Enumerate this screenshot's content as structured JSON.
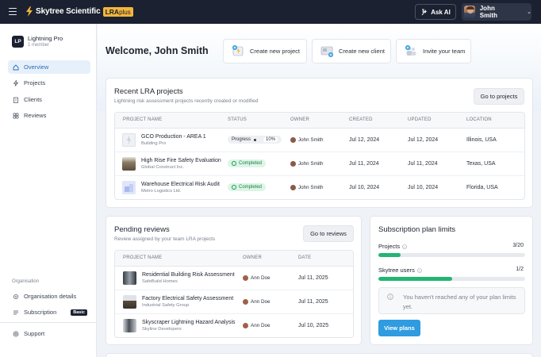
{
  "topbar": {
    "brand_name": "Skytree Scientific",
    "brand_badge": "LRA",
    "brand_badge_suffix": "plus",
    "ask_ai_label": "Ask AI",
    "user_name": "John Smith"
  },
  "sidebar": {
    "org_name": "Lightning Pro",
    "org_initials": "LP",
    "org_members": "1 member",
    "nav": [
      {
        "label": "Overview",
        "icon": "home-icon",
        "active": true
      },
      {
        "label": "Projects",
        "icon": "bolt-icon"
      },
      {
        "label": "Clients",
        "icon": "building-icon"
      },
      {
        "label": "Reviews",
        "icon": "reviews-icon"
      }
    ],
    "section_label": "Organisation",
    "org_nav": [
      {
        "label": "Organisation details",
        "icon": "settings-icon"
      },
      {
        "label": "Subscription",
        "icon": "subscription-icon",
        "badge": "Basic"
      }
    ],
    "support_label": "Support"
  },
  "main": {
    "welcome": "Welcome, John Smith",
    "quick_actions": [
      {
        "label": "Create new project",
        "icon": "new-project-icon"
      },
      {
        "label": "Create new client",
        "icon": "new-client-icon"
      },
      {
        "label": "Invite your team",
        "icon": "invite-team-icon"
      }
    ]
  },
  "recent_projects": {
    "title": "Recent LRA projects",
    "subtitle": "Lightning risk assessment projects recently created or modified",
    "button": "Go to projects",
    "columns": [
      "PROJECT NAME",
      "STATUS",
      "OWNER",
      "CREATED",
      "UPDATED",
      "LOCATION"
    ],
    "rows": [
      {
        "name": "GCO Production - AREA 1",
        "client": "Building Pro",
        "status": "Progress",
        "status_type": "progress",
        "percent": "10%",
        "owner": "John Smith",
        "created": "Jul 12, 2024",
        "updated": "Jul 12, 2024",
        "location": "Illinois, USA"
      },
      {
        "name": "High Rise Fire Safety Evaluation",
        "client": "Global Construct Inc.",
        "status": "Completed",
        "status_type": "completed",
        "owner": "John Smith",
        "created": "Jul 11, 2024",
        "updated": "Jul 11, 2024",
        "location": "Texas, USA"
      },
      {
        "name": "Warehouse Electrical Risk Audit",
        "client": "Metro Logistics Ltd.",
        "status": "Completed",
        "status_type": "completed",
        "owner": "John Smith",
        "created": "Jul 10, 2024",
        "updated": "Jul 10, 2024",
        "location": "Florida, USA"
      }
    ]
  },
  "pending_reviews": {
    "title": "Pending reviews",
    "subtitle": "Review assigned by your team LRA projects",
    "button": "Go to reviews",
    "columns": [
      "PROJECT NAME",
      "OWNER",
      "DATE"
    ],
    "rows": [
      {
        "name": "Residential Building Risk Assessment",
        "client": "SafeBuild Homes",
        "owner": "Ann Doe",
        "date": "Jul 11, 2025"
      },
      {
        "name": "Factory Electrical Safety Assessment",
        "client": "Industrial Safety Group",
        "owner": "Ann Doe",
        "date": "Jul 11, 2025"
      },
      {
        "name": "Skyscraper Lightning Hazard Analysis",
        "client": "Skyline Developers",
        "owner": "Ann Doe",
        "date": "Jul 10, 2025"
      }
    ]
  },
  "subscription": {
    "title": "Subscription plan limits",
    "projects_label": "Projects",
    "projects_count": "3/20",
    "projects_used": 3,
    "projects_limit": 20,
    "users_label": "Skytree users",
    "users_count": "1/2",
    "users_used": 1,
    "users_limit": 2,
    "info_text": "You haven't reached any of your plan limits yet.",
    "button": "View plans",
    "accent_color": "#22b573"
  }
}
